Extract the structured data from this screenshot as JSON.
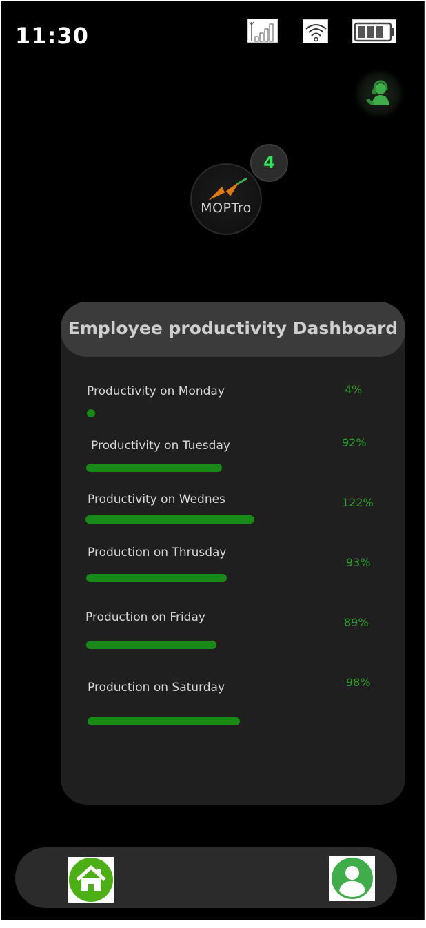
{
  "status_bar": {
    "time": "11:30",
    "icons": [
      "signal-icon",
      "wifi-icon",
      "battery-icon"
    ]
  },
  "header": {
    "support_icon": "customer-support-icon",
    "logo_text": "MOPTro",
    "notification_count": "4"
  },
  "dashboard": {
    "title": "Employee productivity Dashboard",
    "rows": [
      {
        "label": "Productivity on  Monday",
        "percent_text": "4%",
        "level": 0.04
      },
      {
        "label": "Productivity on Tuesday",
        "percent_text": "92%",
        "level": 0.92
      },
      {
        "label": "Productivity on Wednesday",
        "percent_text": "122%",
        "level": 1.22
      },
      {
        "label": "Production on Thrusday",
        "percent_text": "93%",
        "level": 0.93
      },
      {
        "label": "Production on Friday",
        "percent_text": "89%",
        "level": 0.89
      },
      {
        "label": "Production on Saturday",
        "percent_text": "98%",
        "level": 0.98
      }
    ]
  },
  "bottom_nav": {
    "items": [
      "home-icon",
      "profile-icon"
    ]
  },
  "colors": {
    "accent_green": "#178a17",
    "percent_green": "#2aa32a",
    "badge_green": "#36e25a",
    "nav_green": "#4caf15"
  }
}
